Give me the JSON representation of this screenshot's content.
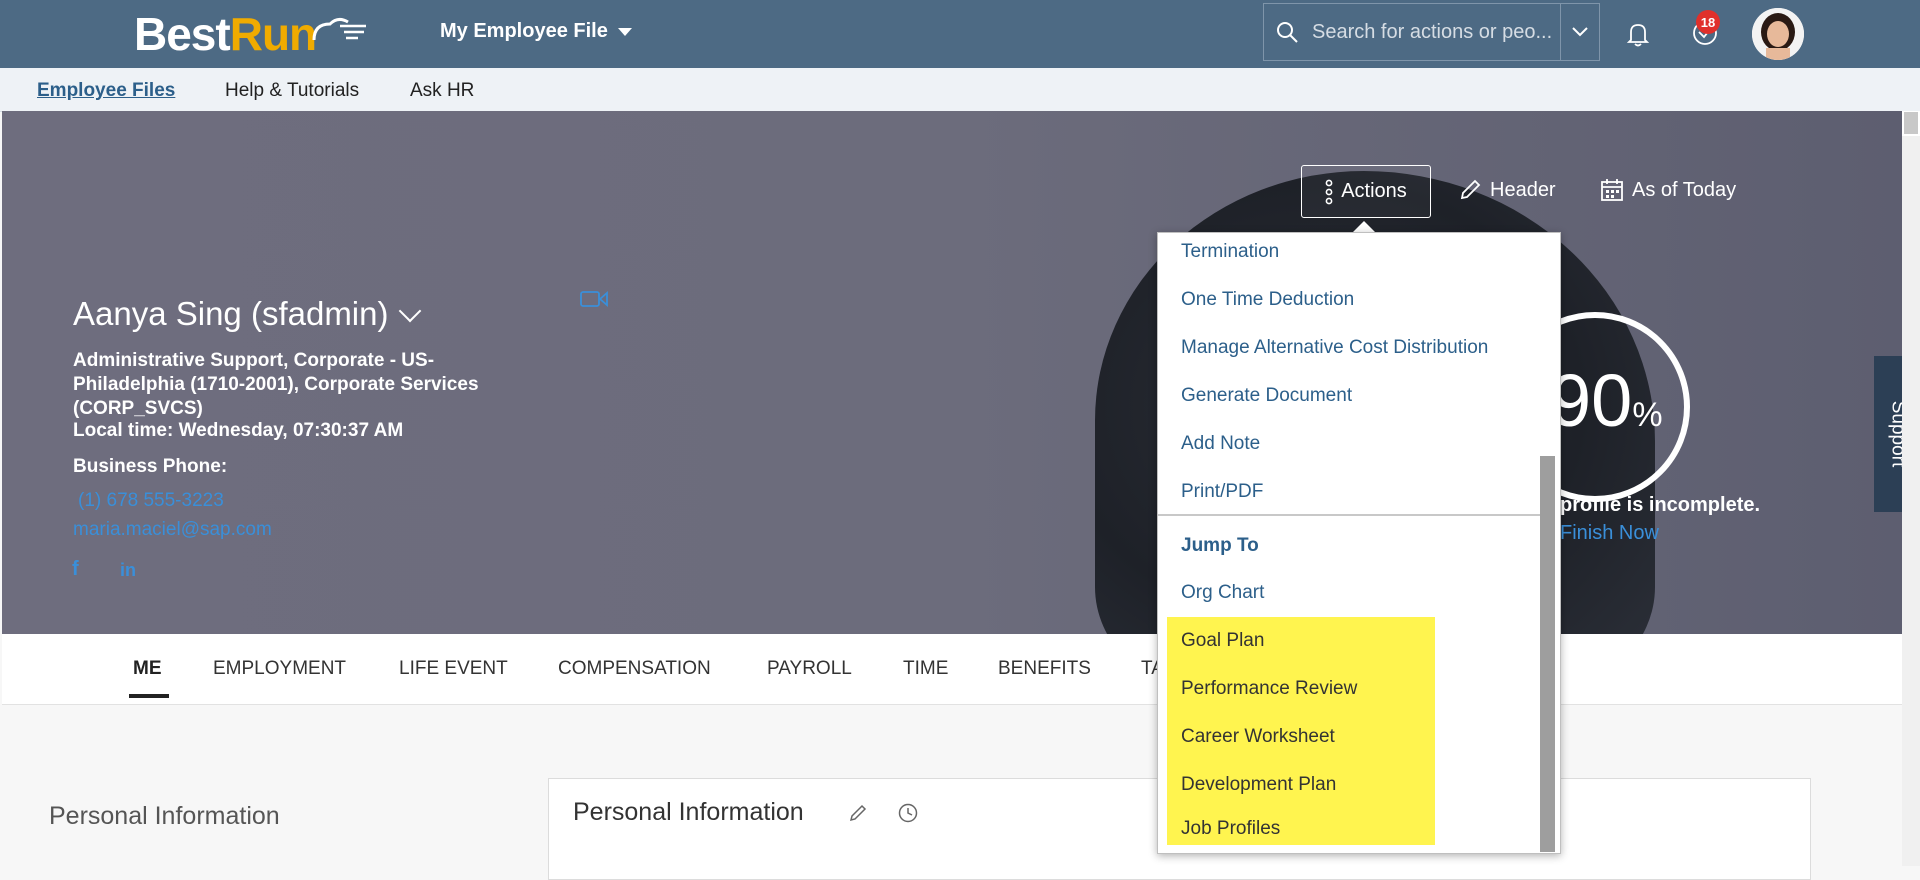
{
  "shell": {
    "logo_best": "Best",
    "logo_run": "Run",
    "app_menu_label": "My Employee File",
    "search_placeholder": "Search for actions or peo...",
    "notification_count": "18"
  },
  "subnav": {
    "items": [
      {
        "label": "Employee Files",
        "active": true
      },
      {
        "label": "Help & Tutorials"
      },
      {
        "label": "Ask HR"
      }
    ]
  },
  "profile": {
    "name": "Aanya Sing (sfadmin)",
    "job_info": "Administrative Support, Corporate - US-Philadelphia (1710-2001), Corporate Services (CORP_SVCS)",
    "local_time": "Local time: Wednesday, 07:30:37 AM",
    "business_phone_label": "Business Phone:",
    "phone": "(1) 678 555-3223",
    "email": "maria.maciel@sap.com",
    "completion_value": "90",
    "completion_unit": "%",
    "incomplete_text": "profile is incomplete.",
    "finish_now": "Finish Now"
  },
  "header_actions": {
    "actions": "Actions",
    "header": "Header",
    "as_of_today": "As of Today"
  },
  "actions_menu": {
    "items": [
      "Termination",
      "One Time Deduction",
      "Manage Alternative Cost Distribution",
      "Generate Document",
      "Add Note",
      "Print/PDF"
    ],
    "jump_to_label": "Jump To",
    "jump_items": [
      "Org Chart",
      "Goal Plan",
      "Performance Review",
      "Career Worksheet",
      "Development Plan",
      "Job Profiles"
    ],
    "highlight_color": "#fff44f"
  },
  "tabs": [
    "ME",
    "EMPLOYMENT",
    "LIFE EVENT",
    "COMPENSATION",
    "PAYROLL",
    "TIME",
    "BENEFITS",
    "TA"
  ],
  "content": {
    "side_title": "Personal Information",
    "card_title": "Personal Information"
  },
  "support_label": "Support",
  "colors": {
    "shell": "#4d6a84",
    "link": "#2c5f8a",
    "accent": "#f0ab00"
  }
}
